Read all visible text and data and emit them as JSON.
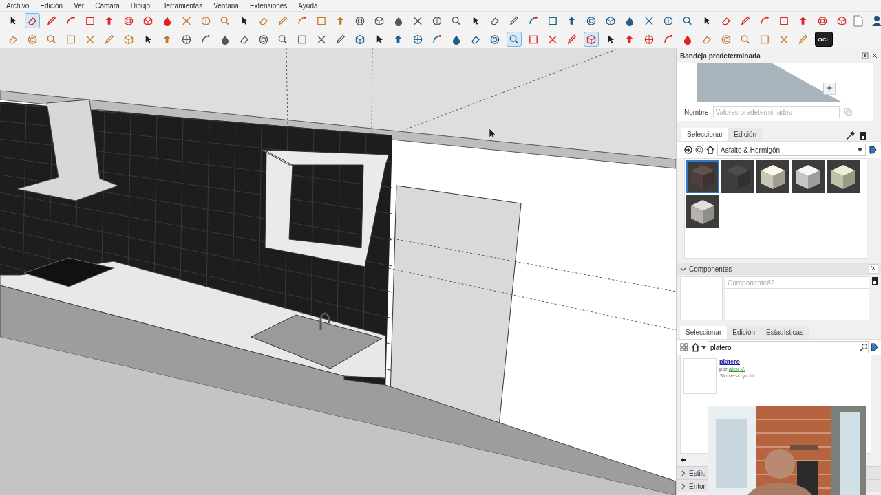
{
  "menu": [
    "Archivo",
    "Edición",
    "Ver",
    "Cámara",
    "Dibujo",
    "Herramientas",
    "Ventana",
    "Extensiones",
    "Ayuda"
  ],
  "toolbar_1": [
    {
      "selected": false
    },
    {
      "selected": true
    },
    {
      "selected": false
    },
    {
      "selected": false
    },
    {
      "selected": false
    },
    {
      "selected": false
    },
    {
      "selected": false
    },
    {
      "selected": false
    },
    {
      "selected": false
    },
    {
      "selected": false
    },
    {
      "selected": false
    },
    {
      "selected": false
    },
    {
      "selected": false
    },
    {
      "selected": false
    },
    {
      "selected": false
    },
    {
      "selected": false
    },
    {
      "selected": false
    },
    {
      "selected": false
    },
    {
      "selected": false
    },
    {
      "selected": false
    },
    {
      "selected": false
    },
    {
      "selected": false
    },
    {
      "selected": false
    },
    {
      "selected": false
    },
    {
      "selected": false
    },
    {
      "selected": false
    },
    {
      "selected": false
    },
    {
      "selected": false
    },
    {
      "selected": false
    },
    {
      "selected": false
    },
    {
      "selected": false
    },
    {
      "selected": false
    },
    {
      "selected": false
    },
    {
      "selected": false
    },
    {
      "selected": false
    },
    {
      "selected": false
    },
    {
      "selected": false
    },
    {
      "selected": false
    },
    {
      "selected": false
    },
    {
      "selected": false
    },
    {
      "selected": false
    },
    {
      "selected": false
    },
    {
      "selected": false
    },
    {
      "selected": false
    }
  ],
  "toolbar_2": [
    {
      "selected": false
    },
    {
      "selected": false
    },
    {
      "selected": false
    },
    {
      "selected": false
    },
    {
      "selected": false
    },
    {
      "selected": false
    },
    {
      "selected": false
    },
    {
      "selected": false
    },
    {
      "selected": false
    },
    {
      "selected": false
    },
    {
      "selected": false
    },
    {
      "selected": false
    },
    {
      "selected": false
    },
    {
      "selected": false
    },
    {
      "selected": false
    },
    {
      "selected": false
    },
    {
      "selected": false
    },
    {
      "selected": false
    },
    {
      "selected": false
    },
    {
      "selected": false
    },
    {
      "selected": false
    },
    {
      "selected": false
    },
    {
      "selected": false
    },
    {
      "selected": false
    },
    {
      "selected": false
    },
    {
      "selected": false
    },
    {
      "selected": true
    },
    {
      "selected": false
    },
    {
      "selected": false
    },
    {
      "selected": false
    },
    {
      "selected": true
    },
    {
      "selected": false
    },
    {
      "selected": false
    },
    {
      "selected": false
    },
    {
      "selected": false
    },
    {
      "selected": false
    },
    {
      "selected": false
    },
    {
      "selected": false
    },
    {
      "selected": false
    },
    {
      "selected": false
    },
    {
      "selected": false
    },
    {
      "selected": false
    }
  ],
  "toolbar_2_text_button": "OCL",
  "tray": {
    "title": "Bandeja predeterminada",
    "styles": {
      "name_label": "Nombre",
      "name_placeholder": "Valores predeterminados"
    },
    "materials": {
      "tabs": [
        {
          "label": "Seleccionar",
          "selected": true
        },
        {
          "label": "Edición",
          "selected": false
        }
      ],
      "library": "Asfalto & Hormigón",
      "swatches": [
        {
          "color": "#4d3f3c",
          "selected": true
        },
        {
          "color": "#3f3d3b",
          "selected": false
        },
        {
          "color": "#c9c7b8",
          "selected": false
        },
        {
          "color": "#c6c6c4",
          "selected": false
        },
        {
          "color": "#bfbfaa",
          "selected": false
        },
        {
          "color": "#b4b2ab",
          "selected": false
        }
      ]
    },
    "components": {
      "title": "Componentes",
      "expanded": true,
      "name_placeholder": "Componente#2",
      "tabs": [
        {
          "label": "Seleccionar",
          "selected": true
        },
        {
          "label": "Edición",
          "selected": false
        },
        {
          "label": "Estadísticas",
          "selected": false
        }
      ],
      "search": "platero",
      "results": [
        {
          "title": "platero",
          "by": "por",
          "author": "alex V.",
          "description": "Sin descripción"
        }
      ]
    },
    "collapsed_sections": [
      {
        "title": "Estilo",
        "expanded": false
      },
      {
        "title": "Entor",
        "expanded": false
      }
    ]
  }
}
